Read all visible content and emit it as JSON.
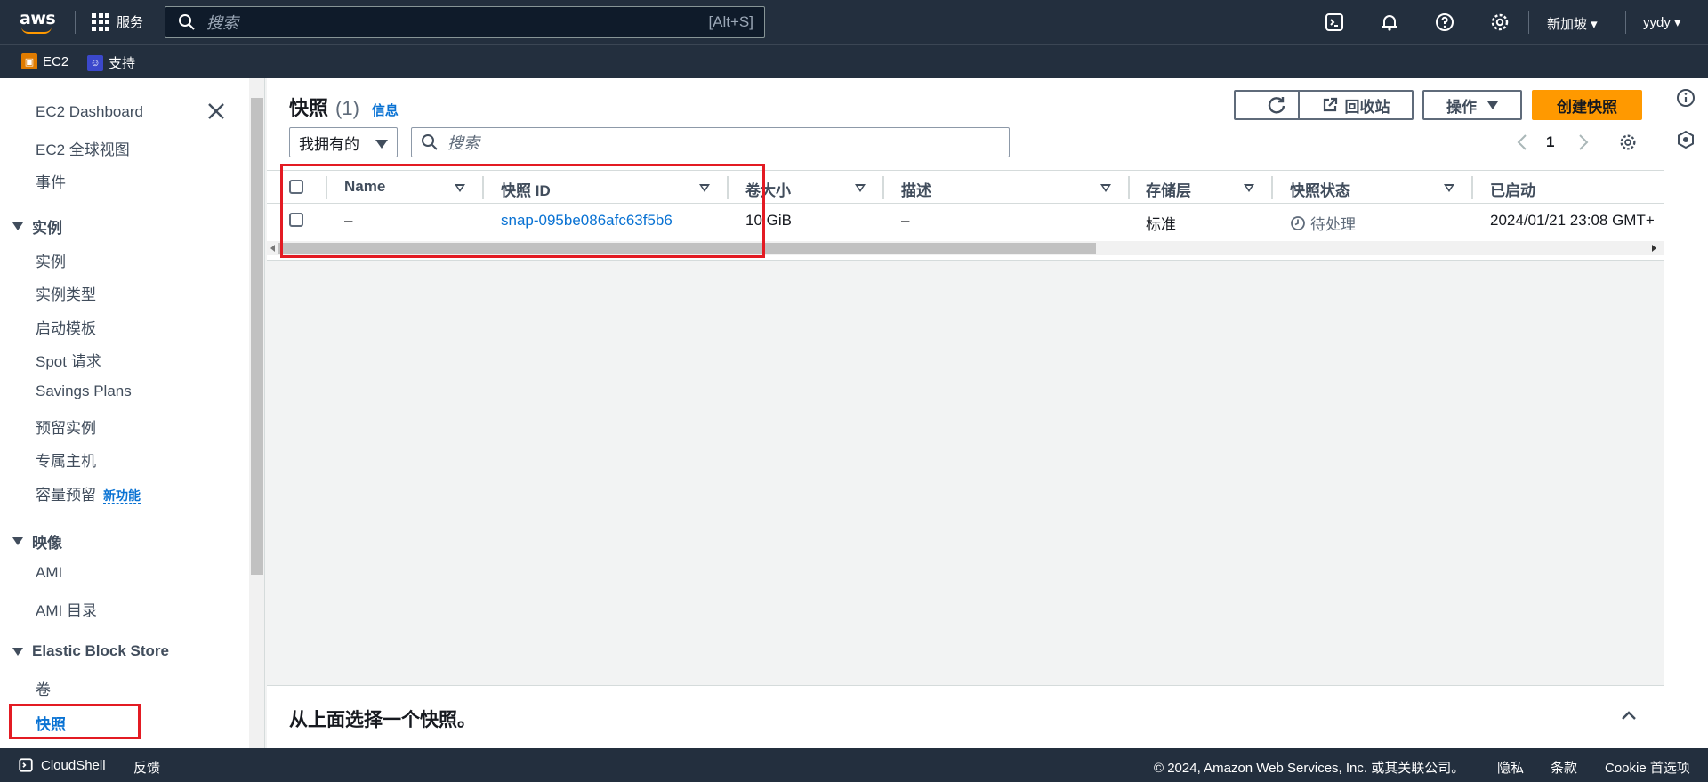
{
  "topbar": {
    "logo_text": "aws",
    "services_label": "服务",
    "search_placeholder": "搜索",
    "search_shortcut": "[Alt+S]",
    "region": "新加坡 ▾",
    "user": "yydy ▾"
  },
  "favorites": [
    {
      "label": "EC2",
      "icon": "ec2-icon",
      "color": "#e07b00"
    },
    {
      "label": "支持",
      "icon": "support-icon",
      "color": "#3b48cc"
    }
  ],
  "sidebar": {
    "dashboard": "EC2 Dashboard",
    "global_view": "EC2 全球视图",
    "events": "事件",
    "instances_head": "实例",
    "instances": [
      "实例",
      "实例类型",
      "启动模板",
      "Spot 请求",
      "Savings Plans",
      "预留实例",
      "专属主机",
      "容量预留"
    ],
    "new_badge": "新功能",
    "images_head": "映像",
    "images": [
      "AMI",
      "AMI 目录"
    ],
    "ebs_head": "Elastic Block Store",
    "ebs": [
      "卷",
      "快照"
    ],
    "active_item": "快照"
  },
  "panel": {
    "title": "快照",
    "count": "(1)",
    "info_link": "信息",
    "recycle_bin": "回收站",
    "actions": "操作",
    "create": "创建快照",
    "filter_select": "我拥有的",
    "search_placeholder": "搜索",
    "page": "1"
  },
  "table": {
    "columns": [
      "Name",
      "快照 ID",
      "卷大小",
      "描述",
      "存储层",
      "快照状态",
      "已启动"
    ],
    "rows": [
      {
        "name": "–",
        "snapshot_id": "snap-095be086afc63f5b6",
        "size": "10 GiB",
        "description": "–",
        "tier": "标准",
        "status": "待处理",
        "started": "2024/01/21 23:08 GMT+"
      }
    ]
  },
  "split_panel": {
    "title": "从上面选择一个快照。"
  },
  "footer": {
    "cloudshell": "CloudShell",
    "feedback": "反馈",
    "copyright": "© 2024, Amazon Web Services, Inc. 或其关联公司。",
    "privacy": "隐私",
    "terms": "条款",
    "cookie": "Cookie 首选项"
  },
  "colors": {
    "nav_bg": "#232f3e",
    "primary": "#ff9900",
    "link": "#0972d3",
    "highlight": "#e31b23"
  }
}
